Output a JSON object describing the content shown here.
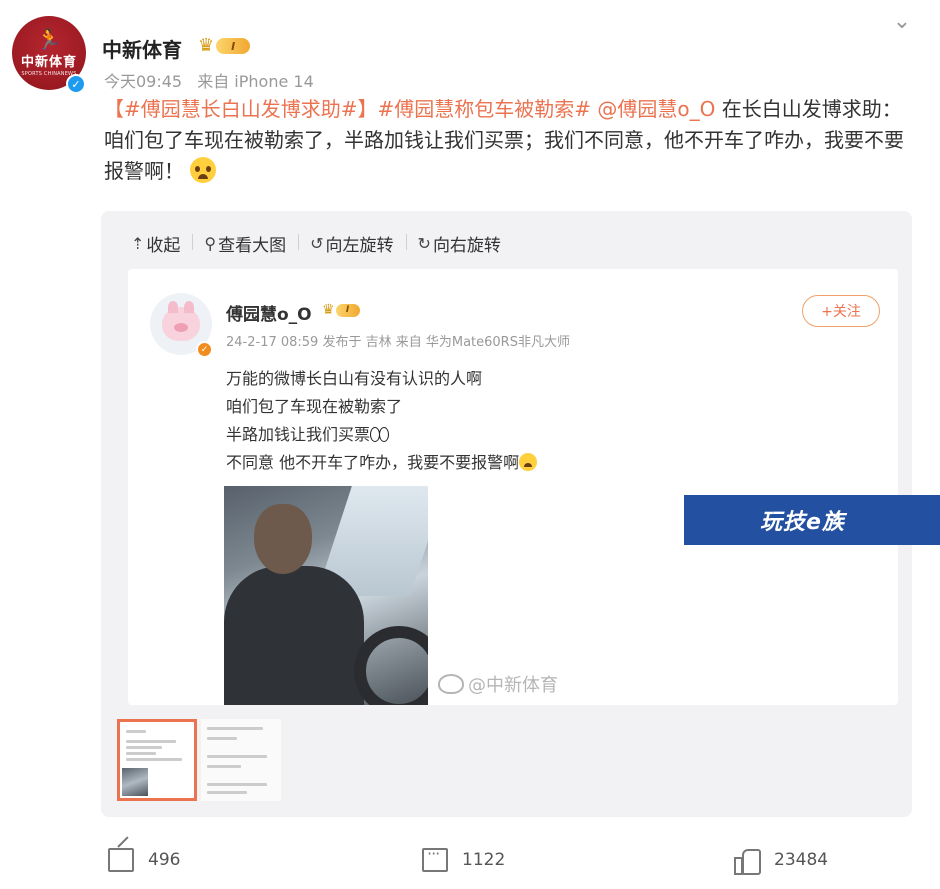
{
  "post": {
    "author": "中新体育",
    "vip_level": "I",
    "avatar_text": "中新体育",
    "avatar_subtext": "SPORTS CHINANEWS",
    "time": "今天09:45",
    "source": "来自 iPhone 14",
    "text": {
      "tag1": "【#傅园慧长白山发博求助#】",
      "tag2": "#傅园慧称包车被勒索#",
      "mention": " @傅园慧o_O",
      "body": " 在长白山发博求助：咱们包了车现在被勒索了，半路加钱让我们买票；我们不同意，他不开车了咋办，我要不要报警啊！"
    }
  },
  "toolbar": {
    "collapse": "收起",
    "view_large": "查看大图",
    "rotate_left": "向左旋转",
    "rotate_right": "向右旋转"
  },
  "screenshot": {
    "name": "傅园慧o_O",
    "vip_level": "I",
    "meta": "24-2-17 08:59 发布于 吉林 来自 华为Mate60RS非凡大师",
    "follow": "+关注",
    "lines": [
      "万能的微博长白山有没有认识的人啊",
      "咱们包了车现在被勒索了",
      "半路加钱让我们买票",
      "不同意 他不开车了咋办，我要不要报警啊"
    ],
    "watermark": "@中新体育"
  },
  "sticker": "玩技e族",
  "actions": {
    "shares": "496",
    "comments": "1122",
    "likes": "23484"
  },
  "colors": {
    "accent": "#eb7350",
    "sticker_bg": "#2350a1",
    "verify_blue": "#1d9bf0"
  }
}
